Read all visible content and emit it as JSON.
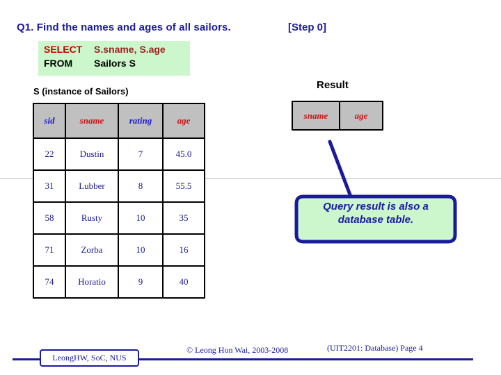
{
  "slide": {
    "title": "Q1. Find the names and ages of all sailors.",
    "step_tag": "[Step 0]",
    "title_color": "#1a1a9c"
  },
  "query_box": {
    "background": "#ccf7cc",
    "lines": [
      {
        "keyword": "SELECT",
        "keyword_color": "#cc0000",
        "args": "S.sname, S.age",
        "args_color": "#9e2020"
      },
      {
        "keyword": "FROM",
        "keyword_color": "#000000",
        "args": "Sailors S",
        "args_color": "#000000"
      }
    ],
    "select_keyword": "SELECT",
    "select_args": "S.sname, S.age",
    "from_keyword": "FROM",
    "from_args": "Sailors S"
  },
  "sailors": {
    "caption": "S (instance of Sailors)",
    "header_background": "#c0c0c0",
    "columns": [
      {
        "label": "sid",
        "color": "#1a1acc"
      },
      {
        "label": "sname",
        "color": "#cc1111"
      },
      {
        "label": "rating",
        "color": "#1a1acc"
      },
      {
        "label": "age",
        "color": "#cc1111"
      }
    ],
    "rows": [
      [
        "22",
        "Dustin",
        "7",
        "45.0"
      ],
      [
        "31",
        "Lubber",
        "8",
        "55.5"
      ],
      [
        "58",
        "Rusty",
        "10",
        "35"
      ],
      [
        "71",
        "Zorba",
        "10",
        "16"
      ],
      [
        "74",
        "Horatio",
        "9",
        "40"
      ]
    ]
  },
  "result": {
    "caption": "Result",
    "header_background": "#c0c0c0",
    "columns": [
      {
        "label": "sname",
        "color": "#cc1111"
      },
      {
        "label": "age",
        "color": "#cc1111"
      }
    ],
    "rows": []
  },
  "callout": {
    "text_line1": "Query result is also a",
    "text_line2": "database table.",
    "fill": "#ccf7cc",
    "stroke": "#1a1a9c"
  },
  "footer": {
    "author_box": "LeongHW, SoC, NUS",
    "copyright": "© Leong Hon Wai, 2003-2008",
    "page_info": "(UIT2201: Database) Page 4",
    "line_color": "#1a1a9c"
  }
}
